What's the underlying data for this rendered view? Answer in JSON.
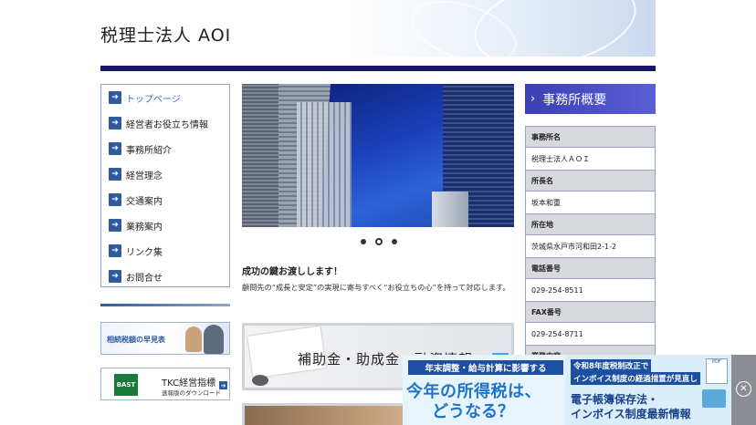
{
  "header": {
    "logo": "税理士法人 AOI"
  },
  "nav": {
    "items": [
      {
        "label": "トップページ",
        "active": true
      },
      {
        "label": "経営者お役立ち情報"
      },
      {
        "label": "事務所紹介"
      },
      {
        "label": "経営理念"
      },
      {
        "label": "交通案内"
      },
      {
        "label": "業務案内"
      },
      {
        "label": "リンク集"
      },
      {
        "label": "お問合せ"
      }
    ],
    "arrow_glyph": "➔"
  },
  "banners": {
    "inheritance": "相続税額の早見表",
    "tkc_badge": "BAST",
    "tkc_title": "TKC経営指標",
    "tkc_sub": "速報版のダウンロード"
  },
  "main": {
    "headline": "成功の鍵お渡しします！",
    "description": "顧問先の“成長と安定”の実現に寄与すべく“お役立ちの心”を持って対応します。",
    "card1_label": "補助金・助成金・融資情報",
    "slider": {
      "count": 3,
      "active": 1
    }
  },
  "sidebar": {
    "title": "事務所概要",
    "rows": [
      {
        "label": "事務所名",
        "value": "税理士法人ＡＯＩ"
      },
      {
        "label": "所長名",
        "value": "坂本和重"
      },
      {
        "label": "所在地",
        "value": "茨城県水戸市河和田2-1-2"
      },
      {
        "label": "電話番号",
        "value": "029-254-8511"
      },
      {
        "label": "FAX番号",
        "value": "029-254-8711"
      },
      {
        "label": "業務内容",
        "value": ""
      }
    ]
  },
  "ad": {
    "left_top": "年末調整・給与計算に影響する",
    "left_mid": "今年の所得税は、",
    "left_bot": "どうなる？",
    "right_1": "令和8年度税制改正で",
    "right_2": "インボイス制度の経過措置が見直し",
    "right_3": "電子帳簿保存法・",
    "right_4": "インボイス制度最新情報",
    "doc_label": "PDF",
    "close_glyph": "✕"
  },
  "colors": {
    "navy": "#14176b",
    "nav_border": "#8fa8c9",
    "side_head": "#3b3fb3"
  }
}
